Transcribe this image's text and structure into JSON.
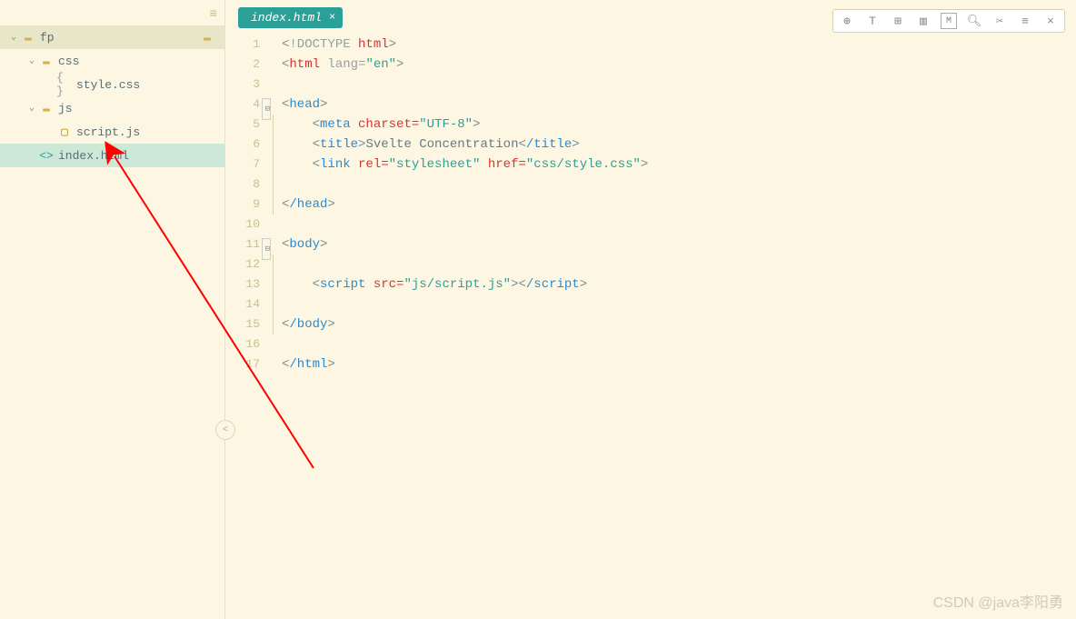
{
  "sidebar": {
    "project": "fp",
    "items": [
      {
        "type": "folder",
        "label": "css",
        "indent": 1
      },
      {
        "type": "file-braces",
        "label": "style.css",
        "indent": 2
      },
      {
        "type": "folder",
        "label": "js",
        "indent": 1
      },
      {
        "type": "file-js",
        "label": "script.js",
        "indent": 2
      },
      {
        "type": "file-html",
        "label": "index.html",
        "indent": 1,
        "active": true
      }
    ]
  },
  "tab": {
    "label": "index.html"
  },
  "lines": [
    {
      "n": "1",
      "fold": ""
    },
    {
      "n": "2",
      "fold": ""
    },
    {
      "n": "3",
      "fold": ""
    },
    {
      "n": "4",
      "fold": "⊟"
    },
    {
      "n": "5",
      "fold": ""
    },
    {
      "n": "6",
      "fold": ""
    },
    {
      "n": "7",
      "fold": ""
    },
    {
      "n": "8",
      "fold": ""
    },
    {
      "n": "9",
      "fold": ""
    },
    {
      "n": "10",
      "fold": ""
    },
    {
      "n": "11",
      "fold": "⊟"
    },
    {
      "n": "12",
      "fold": ""
    },
    {
      "n": "13",
      "fold": ""
    },
    {
      "n": "14",
      "fold": ""
    },
    {
      "n": "15",
      "fold": ""
    },
    {
      "n": "16",
      "fold": ""
    },
    {
      "n": "17",
      "fold": ""
    }
  ],
  "code": {
    "l1_doctype": "!DOCTYPE",
    "l1_html": "html",
    "l2_tag": "html",
    "l2_attr": "lang=",
    "l2_val": "\"en\"",
    "l4_tag": "head",
    "l5_tag": "meta",
    "l5_attr": "charset=",
    "l5_val": "\"UTF-8\"",
    "l6_tag": "title",
    "l6_text": "Svelte Concentration",
    "l6_tag2": "/title",
    "l7_tag": "link",
    "l7_attr1": "rel=",
    "l7_val1": "\"stylesheet\"",
    "l7_attr2": "href=",
    "l7_val2": "\"css/style.css\"",
    "l9_tag": "/head",
    "l11_tag": "body",
    "l13_tag": "script",
    "l13_attr": "src=",
    "l13_val": "\"js/script.js\"",
    "l13_tag2": "/script",
    "l15_tag": "/body",
    "l17_tag": "/html"
  },
  "watermark": "CSDN @java李阳勇"
}
